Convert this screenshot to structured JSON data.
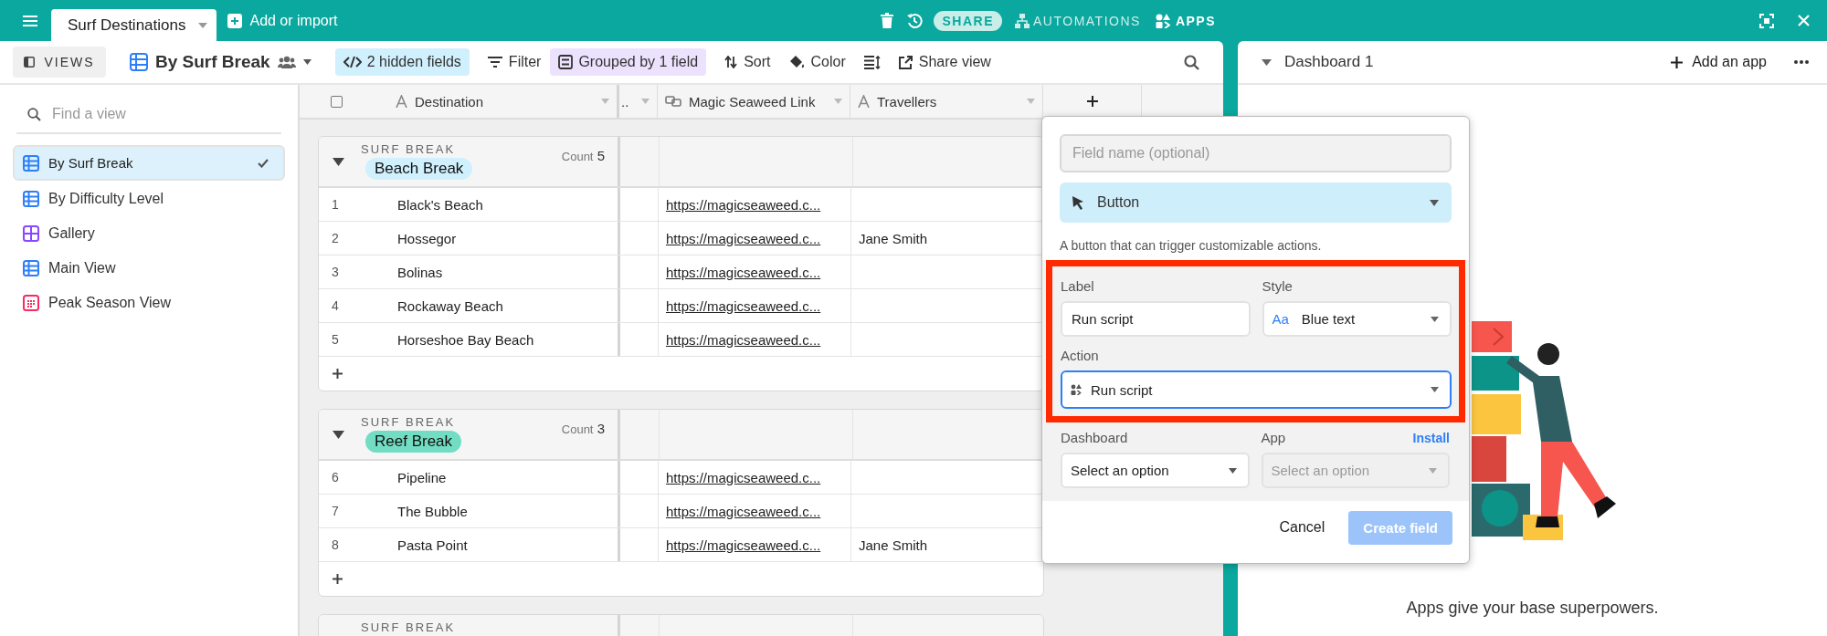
{
  "top_bar": {
    "base_tab": "Surf Destinations",
    "add_import": "Add or import",
    "share": "SHARE",
    "automations": "AUTOMATIONS",
    "apps": "APPS"
  },
  "toolbar": {
    "views": "VIEWS",
    "view_name": "By Surf Break",
    "hidden_fields": "2 hidden fields",
    "filter": "Filter",
    "grouped": "Grouped by 1 field",
    "sort": "Sort",
    "color_button": "Color",
    "share_view": "Share view"
  },
  "sidebar": {
    "search": {
      "placeholder": "Find a view"
    },
    "items": [
      {
        "label": "By Surf Break",
        "kind": "grid",
        "selected": true
      },
      {
        "label": "By Difficulty Level",
        "kind": "grid",
        "selected": false
      },
      {
        "label": "Gallery",
        "kind": "gallery",
        "selected": false
      },
      {
        "label": "Main View",
        "kind": "grid",
        "selected": false
      },
      {
        "label": "Peak Season View",
        "kind": "calendar",
        "selected": false
      }
    ]
  },
  "table": {
    "select_all": {
      "checked": false
    },
    "columns": [
      {
        "label": "Destination",
        "kind": "text"
      },
      {
        "label": "..",
        "kind": "hidden"
      },
      {
        "label": "Magic Seaweed Link",
        "kind": "link"
      },
      {
        "label": "Travellers",
        "kind": "text"
      }
    ],
    "groups": [
      {
        "field": "SURF BREAK",
        "value": "Beach Break",
        "color": "#d0f0fd",
        "count_label": "Count",
        "count": "5",
        "rows": [
          {
            "number": "1",
            "destination": "Black's Beach",
            "link": "https://magicseaweed.c..."
          },
          {
            "number": "2",
            "destination": "Hossegor",
            "link": "https://magicseaweed.c...",
            "travellers": "Jane Smith"
          },
          {
            "number": "3",
            "destination": "Bolinas",
            "link": "https://magicseaweed.c..."
          },
          {
            "number": "4",
            "destination": "Rockaway Beach",
            "link": "https://magicseaweed.c..."
          },
          {
            "number": "5",
            "destination": "Horseshoe Bay Beach",
            "link": "https://magicseaweed.c..."
          }
        ]
      },
      {
        "field": "SURF BREAK",
        "value": "Reef Break",
        "color": "#72ddc3",
        "count_label": "Count",
        "count": "3",
        "rows": [
          {
            "number": "6",
            "destination": "Pipeline",
            "link": "https://magicseaweed.c..."
          },
          {
            "number": "7",
            "destination": "The Bubble",
            "link": "https://magicseaweed.c..."
          },
          {
            "number": "8",
            "destination": "Pasta Point",
            "link": "https://magicseaweed.c...",
            "travellers": "Jane Smith"
          }
        ]
      },
      {
        "field": "SURF BREAK"
      }
    ]
  },
  "dialog": {
    "field_name": {
      "placeholder": "Field name (optional)"
    },
    "type": "Button",
    "description": "A button that can trigger customizable actions.",
    "label": {
      "caption": "Label",
      "value": "Run script"
    },
    "style": {
      "caption": "Style",
      "sample": "Aa",
      "value": "Blue text"
    },
    "action": {
      "caption": "Action",
      "value": "Run script"
    },
    "dashboard": {
      "caption": "Dashboard",
      "value": "Select an option"
    },
    "app": {
      "caption": "App",
      "link": "Install",
      "placeholder": "Select an option",
      "disabled": true
    },
    "cancel": "Cancel",
    "create": {
      "label": "Create field",
      "disabled": true
    }
  },
  "dashboard_panel": {
    "title": "Dashboard 1",
    "add_app": "Add an app",
    "message": "Apps give your base superpowers."
  }
}
